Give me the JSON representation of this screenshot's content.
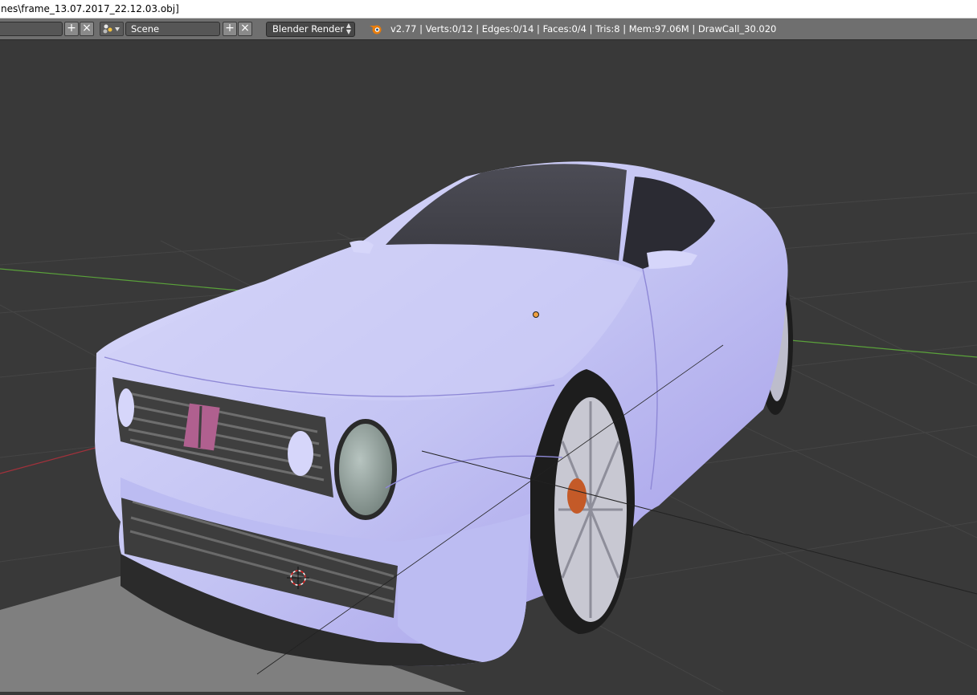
{
  "window": {
    "title": "nes\\frame_13.07.2017_22.12.03.obj]"
  },
  "header": {
    "scene_selector": {
      "icon": "scene-icon",
      "value": "Scene"
    },
    "render_engine": "Blender Render",
    "app_icon": "blender-logo-icon",
    "status_text": "v2.77 | Verts:0/12 | Edges:0/14 | Faces:0/4 | Tris:8 | Mem:97.06M | DrawCall_30.020"
  },
  "colors": {
    "header_bg": "#6f6f6f",
    "viewport_bg": "#393939",
    "car_body": "#c6c6f6",
    "emblem": "#b0608f",
    "hub": "#c45a28",
    "x_axis": "#a3313b",
    "y_axis": "#5aa23a"
  },
  "viewport": {
    "object": "car-model",
    "origin_marker": "object-origin-dot",
    "cursor": "3d-cursor-icon"
  }
}
